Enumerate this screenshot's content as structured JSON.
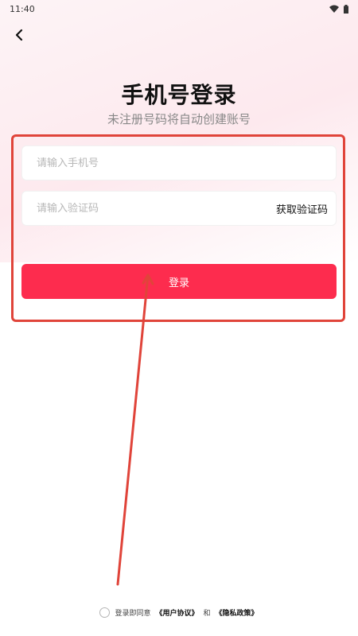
{
  "status_bar": {
    "time": "11:40"
  },
  "header": {
    "title": "手机号登录",
    "subtitle": "未注册号码将自动创建账号"
  },
  "form": {
    "phone_placeholder": "请输入手机号",
    "code_placeholder": "请输入验证码",
    "get_code_label": "获取验证码",
    "login_label": "登录"
  },
  "agreement": {
    "prefix": "登录即同意",
    "user_agreement": "《用户协议》",
    "and": "和",
    "privacy_policy": "《隐私政策》"
  },
  "colors": {
    "accent": "#fd2c4e",
    "annotation": "#e0443a"
  }
}
